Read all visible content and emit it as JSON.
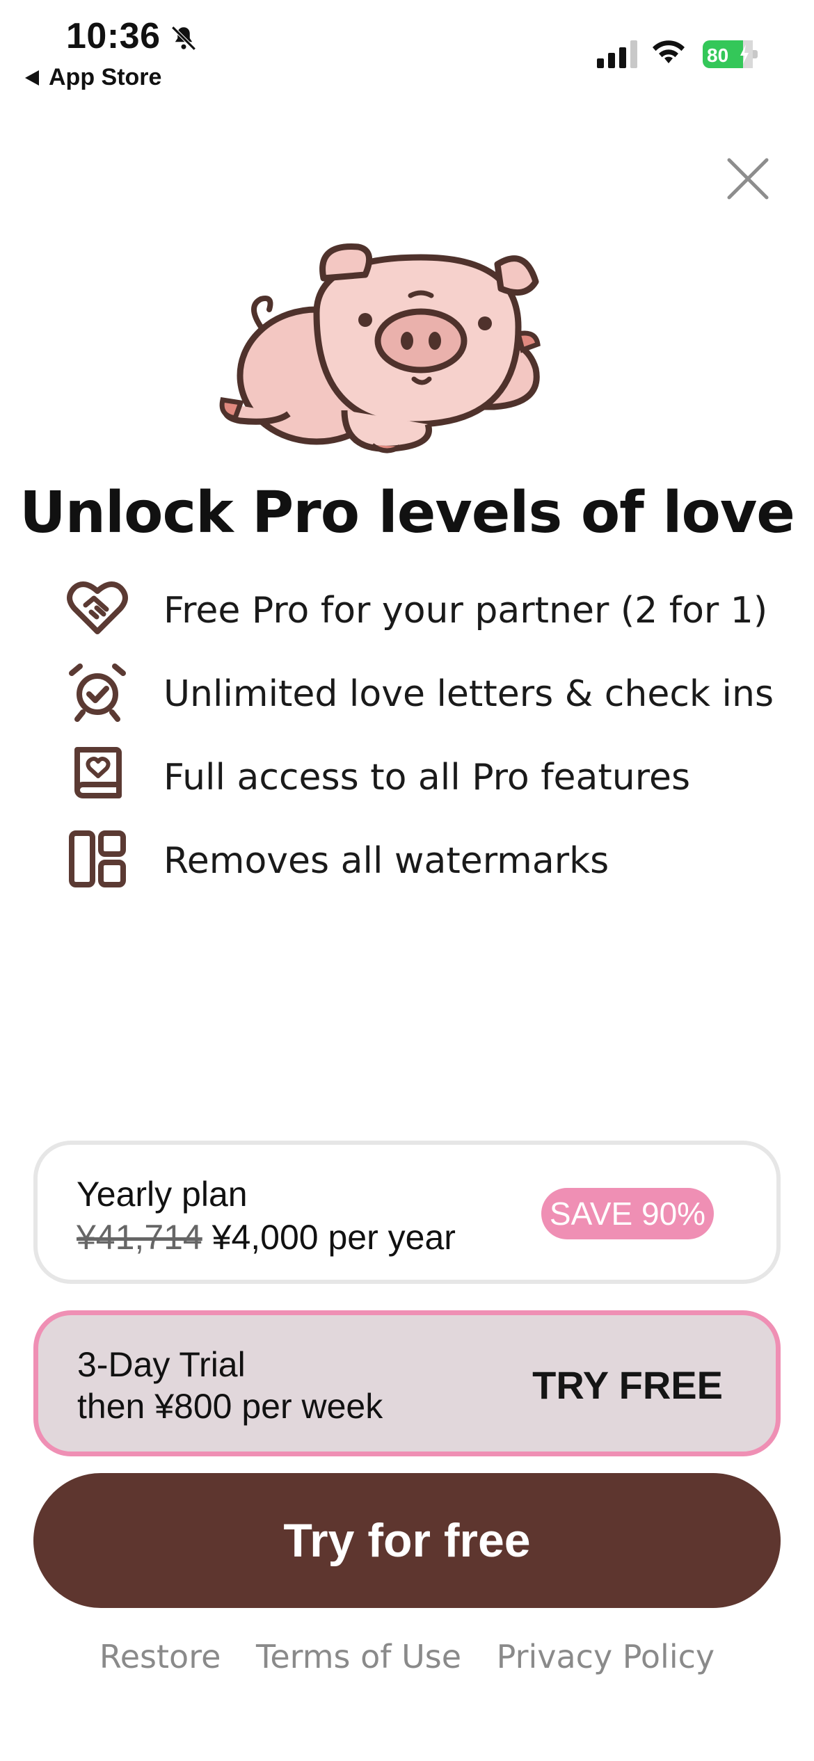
{
  "status_bar": {
    "time": "10:36",
    "back_label": "App Store",
    "battery": "80",
    "icons": [
      "bell-slash-icon",
      "signal-icon",
      "wifi-icon",
      "battery-charging-icon"
    ]
  },
  "close": {
    "icon": "close-icon"
  },
  "hero": {
    "image": "pig-illustration"
  },
  "title": "Unlock Pro levels of love",
  "features": [
    {
      "icon": "heart-handshake-icon",
      "label": "Free Pro for your partner (2 for 1)"
    },
    {
      "icon": "alarm-clock-icon",
      "label": "Unlimited love letters & check ins"
    },
    {
      "icon": "heart-book-icon",
      "label": "Full access to all Pro features"
    },
    {
      "icon": "layout-grid-icon",
      "label": "Removes all watermarks"
    }
  ],
  "plans": {
    "yearly": {
      "name": "Yearly plan",
      "old_price": "¥41,714",
      "price": "¥4,000 per year",
      "badge": "SAVE 90%"
    },
    "trial": {
      "name": "3-Day Trial",
      "price": "then ¥800 per week",
      "tag": "TRY FREE",
      "selected": true
    }
  },
  "cta": {
    "label": "Try for free"
  },
  "footer": {
    "restore": "Restore",
    "terms": "Terms of Use",
    "privacy": "Privacy Policy"
  },
  "colors": {
    "accent_pink": "#ef8fb4",
    "cta_brown": "#5e362f",
    "icon_brown": "#5b3a33",
    "selected_plan_bg": "#e1d7db",
    "battery_green": "#34c759"
  }
}
